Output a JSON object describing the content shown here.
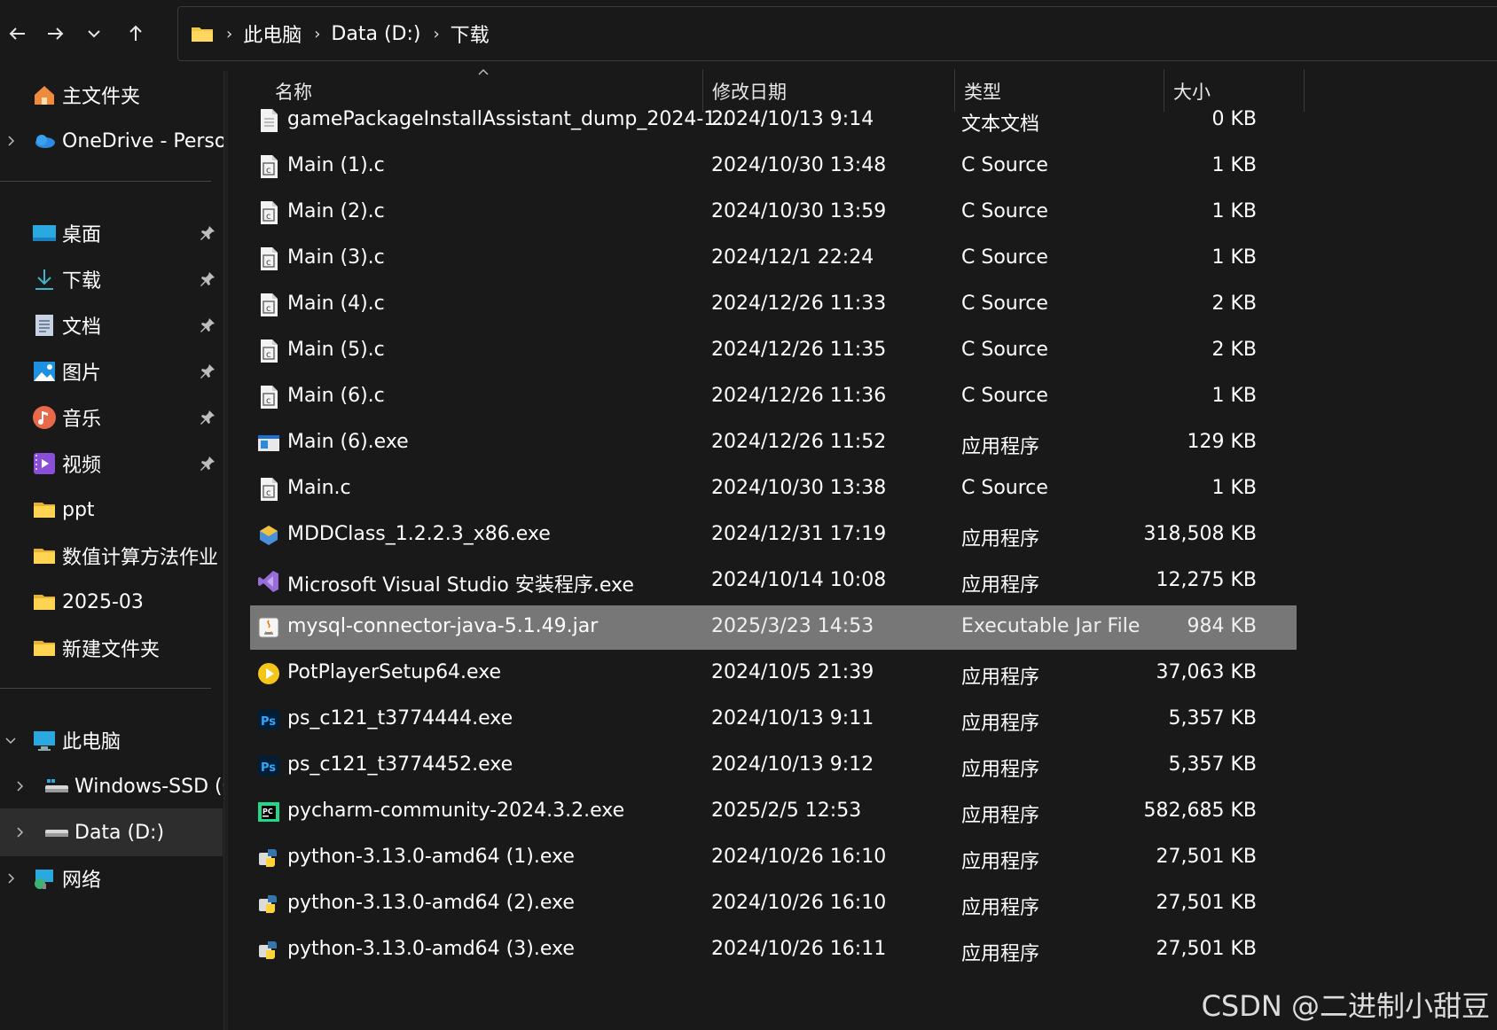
{
  "breadcrumb": [
    "此电脑",
    "Data (D:)",
    "下载"
  ],
  "sidebar": {
    "top": [
      {
        "label": "主文件夹",
        "icon": "home-icon"
      },
      {
        "label": "OneDrive - Persor",
        "icon": "onedrive-cloud-icon"
      }
    ],
    "quick": [
      {
        "label": "桌面",
        "icon": "desktop-icon",
        "pinned": true
      },
      {
        "label": "下载",
        "icon": "download-icon",
        "pinned": true
      },
      {
        "label": "文档",
        "icon": "document-icon",
        "pinned": true
      },
      {
        "label": "图片",
        "icon": "pictures-icon",
        "pinned": true
      },
      {
        "label": "音乐",
        "icon": "music-icon",
        "pinned": true
      },
      {
        "label": "视频",
        "icon": "video-icon",
        "pinned": true
      },
      {
        "label": "ppt",
        "icon": "folder-icon",
        "pinned": false
      },
      {
        "label": "数值计算方法作业",
        "icon": "folder-icon",
        "pinned": false
      },
      {
        "label": "2025-03",
        "icon": "folder-icon",
        "pinned": false
      },
      {
        "label": "新建文件夹",
        "icon": "folder-icon",
        "pinned": false
      }
    ],
    "tree": [
      {
        "label": "此电脑",
        "icon": "computer-icon"
      },
      {
        "label": "Windows-SSD (C",
        "icon": "drive-icon"
      },
      {
        "label": "Data (D:)",
        "icon": "drive-icon",
        "selected": true
      },
      {
        "label": "网络",
        "icon": "network-icon"
      }
    ]
  },
  "columns": {
    "name": "名称",
    "date": "修改日期",
    "type": "类型",
    "size": "大小"
  },
  "files": [
    {
      "name": "gamePackageInstallAssistant_dump_2024-1...",
      "date": "2024/10/13 9:14",
      "type": "文本文档",
      "size": "0 KB",
      "icon": "text-file-icon"
    },
    {
      "name": "Main (1).c",
      "date": "2024/10/30 13:48",
      "type": "C Source",
      "size": "1 KB",
      "icon": "c-source-icon"
    },
    {
      "name": "Main (2).c",
      "date": "2024/10/30 13:59",
      "type": "C Source",
      "size": "1 KB",
      "icon": "c-source-icon"
    },
    {
      "name": "Main (3).c",
      "date": "2024/12/1 22:24",
      "type": "C Source",
      "size": "1 KB",
      "icon": "c-source-icon"
    },
    {
      "name": "Main (4).c",
      "date": "2024/12/26 11:33",
      "type": "C Source",
      "size": "2 KB",
      "icon": "c-source-icon"
    },
    {
      "name": "Main (5).c",
      "date": "2024/12/26 11:35",
      "type": "C Source",
      "size": "2 KB",
      "icon": "c-source-icon"
    },
    {
      "name": "Main (6).c",
      "date": "2024/12/26 11:36",
      "type": "C Source",
      "size": "1 KB",
      "icon": "c-source-icon"
    },
    {
      "name": "Main (6).exe",
      "date": "2024/12/26 11:52",
      "type": "应用程序",
      "size": "129 KB",
      "icon": "exe-window-icon"
    },
    {
      "name": "Main.c",
      "date": "2024/10/30 13:38",
      "type": "C Source",
      "size": "1 KB",
      "icon": "c-source-icon"
    },
    {
      "name": "MDDClass_1.2.2.3_x86.exe",
      "date": "2024/12/31 17:19",
      "type": "应用程序",
      "size": "318,508 KB",
      "icon": "installer-icon"
    },
    {
      "name": "Microsoft Visual Studio 安装程序.exe",
      "date": "2024/10/14 10:08",
      "type": "应用程序",
      "size": "12,275 KB",
      "icon": "visual-studio-icon"
    },
    {
      "name": "mysql-connector-java-5.1.49.jar",
      "date": "2025/3/23 14:53",
      "type": "Executable Jar File",
      "size": "984 KB",
      "icon": "java-jar-icon",
      "selected": true
    },
    {
      "name": "PotPlayerSetup64.exe",
      "date": "2024/10/5 21:39",
      "type": "应用程序",
      "size": "37,063 KB",
      "icon": "potplayer-icon"
    },
    {
      "name": "ps_c121_t3774444.exe",
      "date": "2024/10/13 9:11",
      "type": "应用程序",
      "size": "5,357 KB",
      "icon": "photoshop-icon"
    },
    {
      "name": "ps_c121_t3774452.exe",
      "date": "2024/10/13 9:12",
      "type": "应用程序",
      "size": "5,357 KB",
      "icon": "photoshop-icon"
    },
    {
      "name": "pycharm-community-2024.3.2.exe",
      "date": "2025/2/5 12:53",
      "type": "应用程序",
      "size": "582,685 KB",
      "icon": "pycharm-icon"
    },
    {
      "name": "python-3.13.0-amd64 (1).exe",
      "date": "2024/10/26 16:10",
      "type": "应用程序",
      "size": "27,501 KB",
      "icon": "python-installer-icon"
    },
    {
      "name": "python-3.13.0-amd64 (2).exe",
      "date": "2024/10/26 16:10",
      "type": "应用程序",
      "size": "27,501 KB",
      "icon": "python-installer-icon"
    },
    {
      "name": "python-3.13.0-amd64 (3).exe",
      "date": "2024/10/26 16:11",
      "type": "应用程序",
      "size": "27,501 KB",
      "icon": "python-installer-icon"
    }
  ],
  "watermark": "CSDN @二进制小甜豆",
  "colors": {
    "background": "#191919",
    "selected_row": "#777777",
    "selected_sidebar": "#2d2d2d",
    "folder": "#f4c542"
  }
}
